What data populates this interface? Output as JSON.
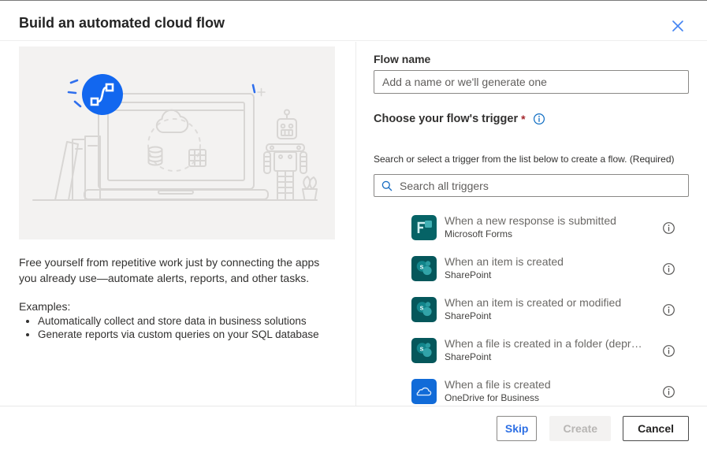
{
  "dialog": {
    "title": "Build an automated cloud flow",
    "close_icon": "close-x-icon"
  },
  "left": {
    "illustration": "laptop-cloud-database-robot-books-line-art",
    "badge_icon": "power-automate-flow-icon",
    "description": "Free yourself from repetitive work just by connecting the apps you already use—automate alerts, reports, and other tasks.",
    "examples_label": "Examples:",
    "examples": [
      "Automatically collect and store data in business solutions",
      "Generate reports via custom queries on your SQL database"
    ]
  },
  "right": {
    "flow_name_label": "Flow name",
    "flow_name_value": "",
    "flow_name_placeholder": "Add a name or we'll generate one",
    "trigger_label": "Choose your flow's trigger",
    "required_asterisk": "*",
    "trigger_info_icon": "info-circle-icon",
    "search_hint": "Search or select a trigger from the list below to create a flow. (Required)",
    "search_icon": "magnifier-icon",
    "search_value": "",
    "search_placeholder": "Search all triggers",
    "triggers": [
      {
        "title": "When a new response is submitted",
        "app": "Microsoft Forms",
        "icon": "forms-icon",
        "info_icon": "info-circle-icon"
      },
      {
        "title": "When an item is created",
        "app": "SharePoint",
        "icon": "sharepoint-icon",
        "info_icon": "info-circle-icon"
      },
      {
        "title": "When an item is created or modified",
        "app": "SharePoint",
        "icon": "sharepoint-icon",
        "info_icon": "info-circle-icon"
      },
      {
        "title": "When a file is created in a folder (depr…",
        "app": "SharePoint",
        "icon": "sharepoint-icon",
        "info_icon": "info-circle-icon"
      },
      {
        "title": "When a file is created",
        "app": "OneDrive for Business",
        "icon": "onedrive-icon",
        "info_icon": "info-circle-icon"
      }
    ]
  },
  "footer": {
    "skip_label": "Skip",
    "create_label": "Create",
    "cancel_label": "Cancel",
    "create_disabled": true
  },
  "colors": {
    "accent_blue": "#1267ef",
    "close_blue": "#4585f2",
    "skip_blue": "#2d6fe4",
    "asterisk_red": "#a4262c",
    "forms_teal": "#066366",
    "sharepoint_teal": "#05575b",
    "onedrive_blue": "#116bd8",
    "illustration_bg": "#f3f2f1"
  }
}
